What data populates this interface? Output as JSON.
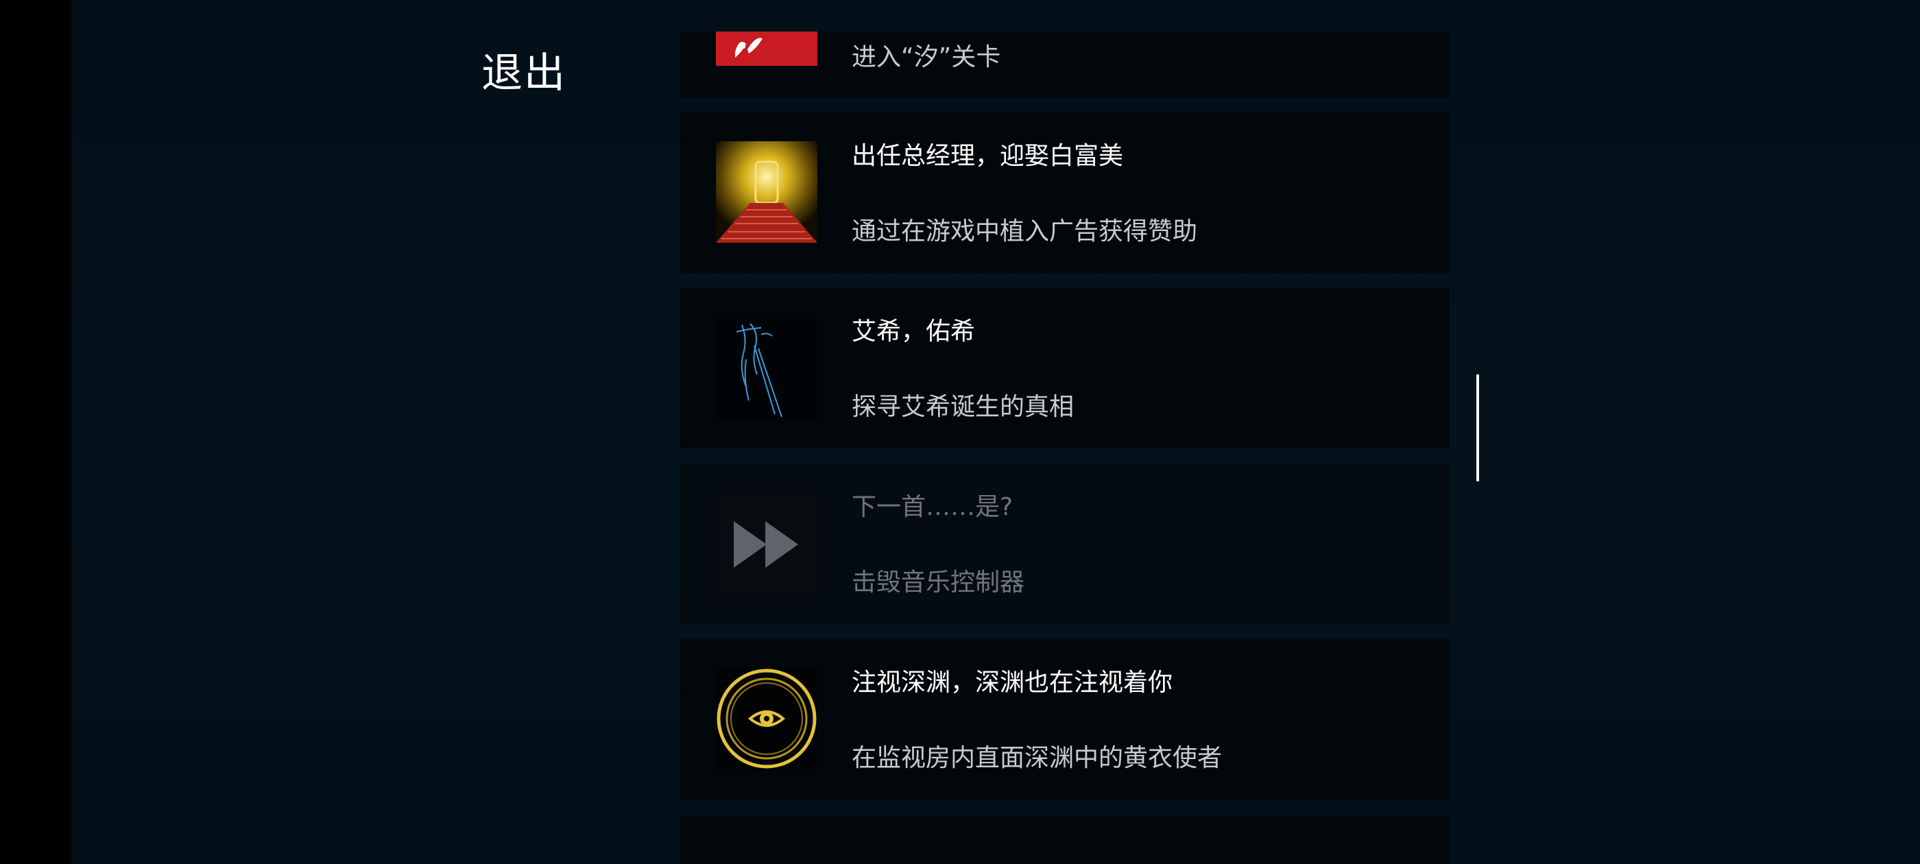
{
  "header": {
    "exit_label": "退出"
  },
  "achievements": [
    {
      "title": "",
      "description": "进入“汐”关卡",
      "icon": "red-crest-icon",
      "unlocked": true
    },
    {
      "title": "出任总经理，迎娶白富美",
      "description": "通过在游戏中植入广告获得赞助",
      "icon": "golden-throne-icon",
      "unlocked": true
    },
    {
      "title": "艾希，佑希",
      "description": "探寻艾希诞生的真相",
      "icon": "blue-scythe-figure-icon",
      "unlocked": true
    },
    {
      "title": "下一首……是?",
      "description": "击毁音乐控制器",
      "icon": "fast-forward-icon",
      "unlocked": false
    },
    {
      "title": "注视深渊，深渊也在注视着你",
      "description": "在监视房内直面深渊中的黄衣使者",
      "icon": "eye-seal-icon",
      "unlocked": true
    }
  ],
  "colors": {
    "background": "#03101a",
    "card": "#02070b",
    "title_text": "#ffffff",
    "desc_text": "#c6ccd0",
    "locked_text": "#6e767c",
    "gold": "#e3c23a"
  }
}
